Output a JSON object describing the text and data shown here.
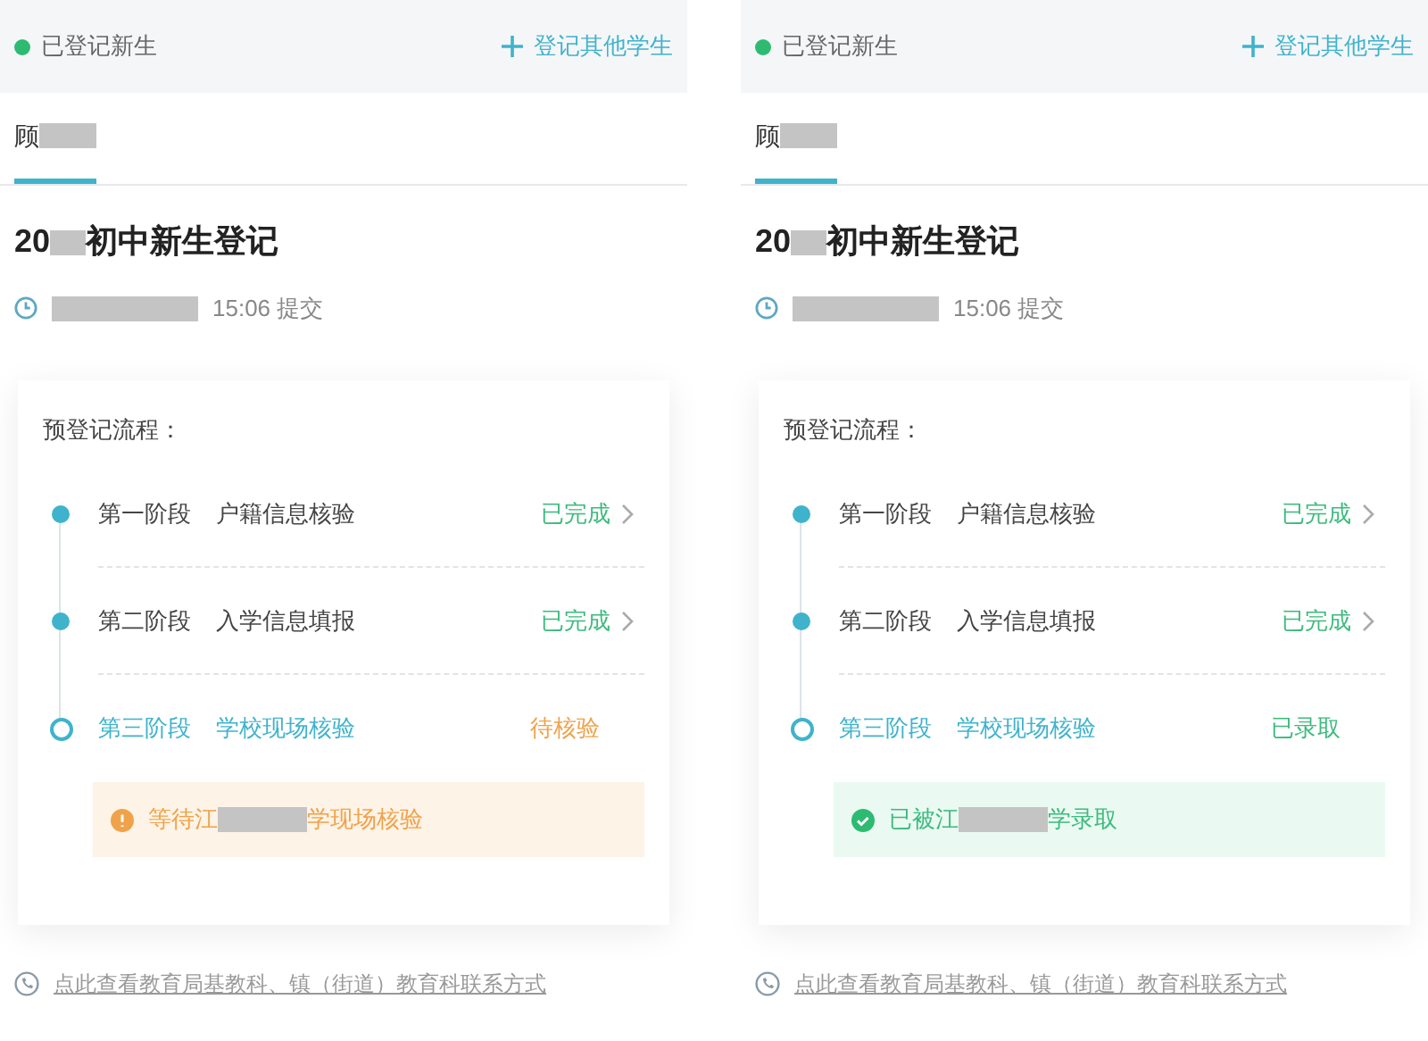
{
  "panels": [
    {
      "header": {
        "status_label": "已登记新生",
        "add_button": "登记其他学生"
      },
      "tab": {
        "label": "顾",
        "selected": true
      },
      "title": {
        "prefix": "20",
        "suffix": "初中新生登记"
      },
      "submit_time": "15:06 提交",
      "process": {
        "title": "预登记流程：",
        "steps": [
          {
            "kind": "done",
            "stage": "第一阶段",
            "name": "户籍信息核验",
            "status": {
              "kind": "done",
              "label": "已完成"
            }
          },
          {
            "kind": "done",
            "stage": "第二阶段",
            "name": "入学信息填报",
            "status": {
              "kind": "done",
              "label": "已完成"
            }
          },
          {
            "kind": "current",
            "stage": "第三阶段",
            "name": "学校现场核验",
            "status": {
              "kind": "pending",
              "label": "待核验"
            }
          }
        ],
        "notice": {
          "kind": "warning",
          "prefix": "等待江",
          "suffix": "学现场核验"
        }
      },
      "contact_link": "点此查看教育局基教科、镇（街道）教育科联系方式"
    },
    {
      "header": {
        "status_label": "已登记新生",
        "add_button": "登记其他学生"
      },
      "tab": {
        "label": "顾",
        "selected": true
      },
      "title": {
        "prefix": "20",
        "suffix": "初中新生登记"
      },
      "submit_time": "15:06 提交",
      "process": {
        "title": "预登记流程：",
        "steps": [
          {
            "kind": "done",
            "stage": "第一阶段",
            "name": "户籍信息核验",
            "status": {
              "kind": "done",
              "label": "已完成"
            }
          },
          {
            "kind": "done",
            "stage": "第二阶段",
            "name": "入学信息填报",
            "status": {
              "kind": "done",
              "label": "已完成"
            }
          },
          {
            "kind": "current",
            "stage": "第三阶段",
            "name": "学校现场核验",
            "status": {
              "kind": "admitted",
              "label": "已录取"
            }
          }
        ],
        "notice": {
          "kind": "success",
          "prefix": "已被江",
          "suffix": "学录取"
        }
      },
      "contact_link": "点此查看教育局基教科、镇（街道）教育科联系方式"
    }
  ]
}
